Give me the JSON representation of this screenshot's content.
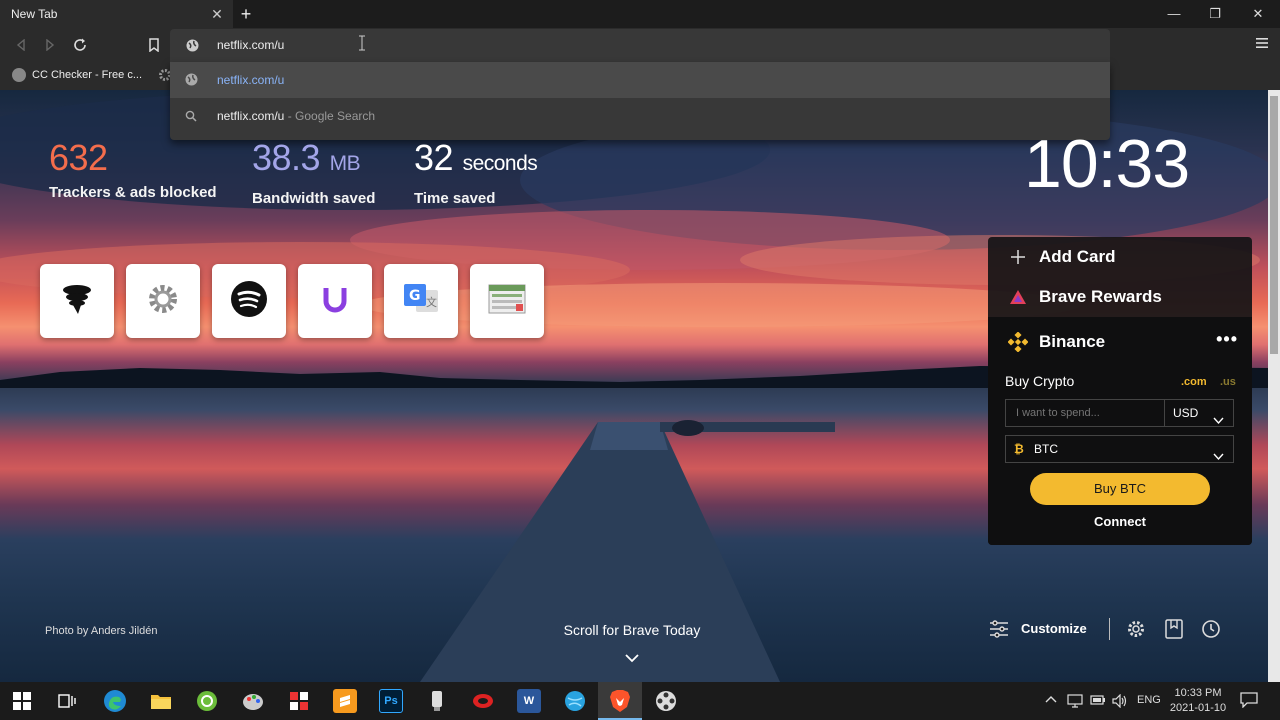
{
  "tab": {
    "title": "New Tab"
  },
  "omnibox": {
    "value": "netflix.com/u"
  },
  "bookmarks": [
    {
      "label": "CC Checker - Free c..."
    }
  ],
  "suggestions": [
    {
      "text": "netflix.com/u",
      "icon": "globe-icon"
    },
    {
      "text": "netflix.com/u",
      "suffix": " - Google Search",
      "icon": "search-icon"
    }
  ],
  "stats": {
    "trackers": {
      "value": "632",
      "label": "Trackers & ads blocked"
    },
    "bandwidth": {
      "value": "38.3",
      "unit": "MB",
      "label": "Bandwidth saved"
    },
    "time": {
      "value": "32",
      "unit": "seconds",
      "label": "Time saved"
    }
  },
  "clock": "10:33",
  "top_sites": [
    {
      "name": "vpn-site",
      "icon": "tornado-icon"
    },
    {
      "name": "settings-site",
      "icon": "gear-icon"
    },
    {
      "name": "spotify-site",
      "icon": "spotify-icon"
    },
    {
      "name": "u-site",
      "icon": "u-logo-icon"
    },
    {
      "name": "translate-site",
      "icon": "translate-icon"
    },
    {
      "name": "sheet-site",
      "icon": "spreadsheet-icon"
    }
  ],
  "cards": {
    "add_card": "Add Card",
    "brave_rewards": "Brave Rewards",
    "binance": {
      "title": "Binance",
      "buy_crypto": "Buy Crypto",
      "domain_com": ".com",
      "domain_us": ".us",
      "amount_placeholder": "I want to spend...",
      "fiat": "USD",
      "coin": "BTC",
      "buy_button": "Buy BTC",
      "connect": "Connect"
    }
  },
  "footer": {
    "photo_by": "Photo by",
    "photographer": "Anders Jildén",
    "scroll_today": "Scroll for Brave Today",
    "customize": "Customize"
  },
  "taskbar": {
    "time": "10:33 PM",
    "date": "2021-01-10",
    "language": "ENG",
    "apps": [
      "start",
      "task-view",
      "edge",
      "file-explorer",
      "app-green",
      "paint",
      "app-puzzle",
      "sublime",
      "photoshop",
      "app-usb",
      "app-red",
      "word",
      "browser-globe",
      "brave",
      "film-reel"
    ]
  },
  "colors": {
    "trackers": "#f36d4c",
    "bandwidth": "#a3a5e8",
    "binance_yellow": "#f3ba2f",
    "link_blue": "#8ab4f8"
  }
}
